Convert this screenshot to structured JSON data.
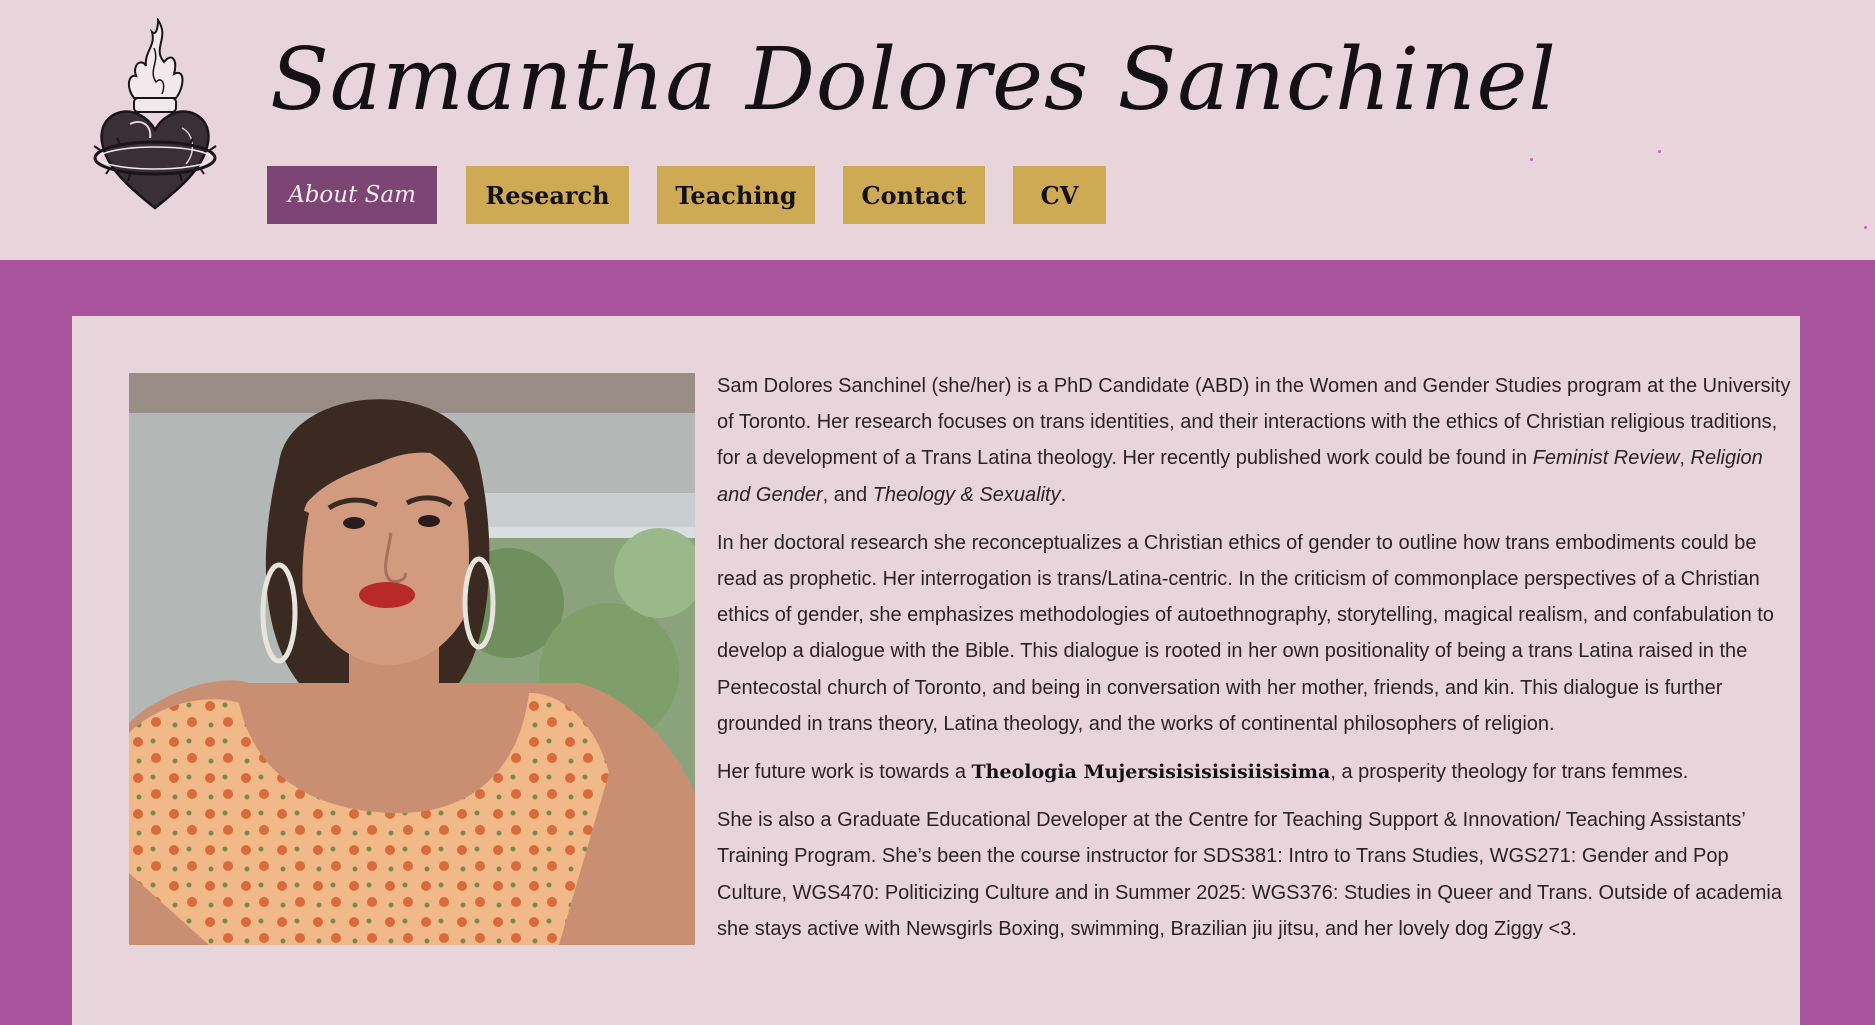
{
  "header": {
    "title": "Samantha Dolores Sanchinel",
    "logo_icon": "sacred-heart-icon"
  },
  "nav": {
    "items": [
      {
        "label": "About Sam",
        "active": true
      },
      {
        "label": "Research",
        "active": false
      },
      {
        "label": "Teaching",
        "active": false
      },
      {
        "label": "Contact",
        "active": false
      },
      {
        "label": "CV",
        "active": false
      }
    ]
  },
  "colors": {
    "header_bg": "#e8d5dc",
    "page_bg": "#a9549c",
    "nav_active": "#7d4574",
    "nav_default": "#ceaa55",
    "card_bg": "#e8d5dc",
    "text": "#2b2226"
  },
  "bio": {
    "p1": {
      "text": "Sam Dolores Sanchinel (she/her) is a PhD Candidate (ABD) in the Women and Gender Studies program at the University of Toronto. Her research focuses on trans identities, and their interactions with the ethics of Christian religious traditions, for a development of a Trans Latina theology. Her recently published work could be found in ",
      "journal1": "Feminist Review",
      "sep1": ", ",
      "journal2": "Religion and Gender",
      "sep2": ", and ",
      "journal3": "Theology & Sexuality",
      "end": "."
    },
    "p2": "In her doctoral research she reconceptualizes a Christian ethics of gender to outline how trans embodiments could be read as prophetic. Her interrogation is trans/Latina-centric. In the criticism of commonplace perspectives of a Christian ethics of gender, she emphasizes methodologies of autoethnography, storytelling, magical realism, and confabulation to develop a dialogue with the Bible. This dialogue is rooted in her own positionality of being a trans Latina raised in the Pentecostal church of Toronto, and being in conversation with her mother, friends, and kin. This dialogue is further grounded in trans theory, Latina theology, and the works of continental philosophers of religion.",
    "p3": {
      "before": "Her future work is towards a ",
      "highlight": "Theologia Mujersisisisisisiisisima",
      "after": ", a prosperity theology for trans femmes."
    },
    "p4": "She is also a Graduate Educational Developer at the Centre for Teaching Support & Innovation/ Teaching Assistants’ Training Program. She’s been the course instructor for SDS381: Intro to Trans Studies, WGS271: Gender and Pop Culture, WGS470: Politicizing Culture and in Summer 2025: WGS376: Studies in Queer and Trans. Outside of academia she stays active with Newsgirls Boxing, swimming, Brazilian jiu jitsu, and her lovely dog Ziggy <3."
  }
}
